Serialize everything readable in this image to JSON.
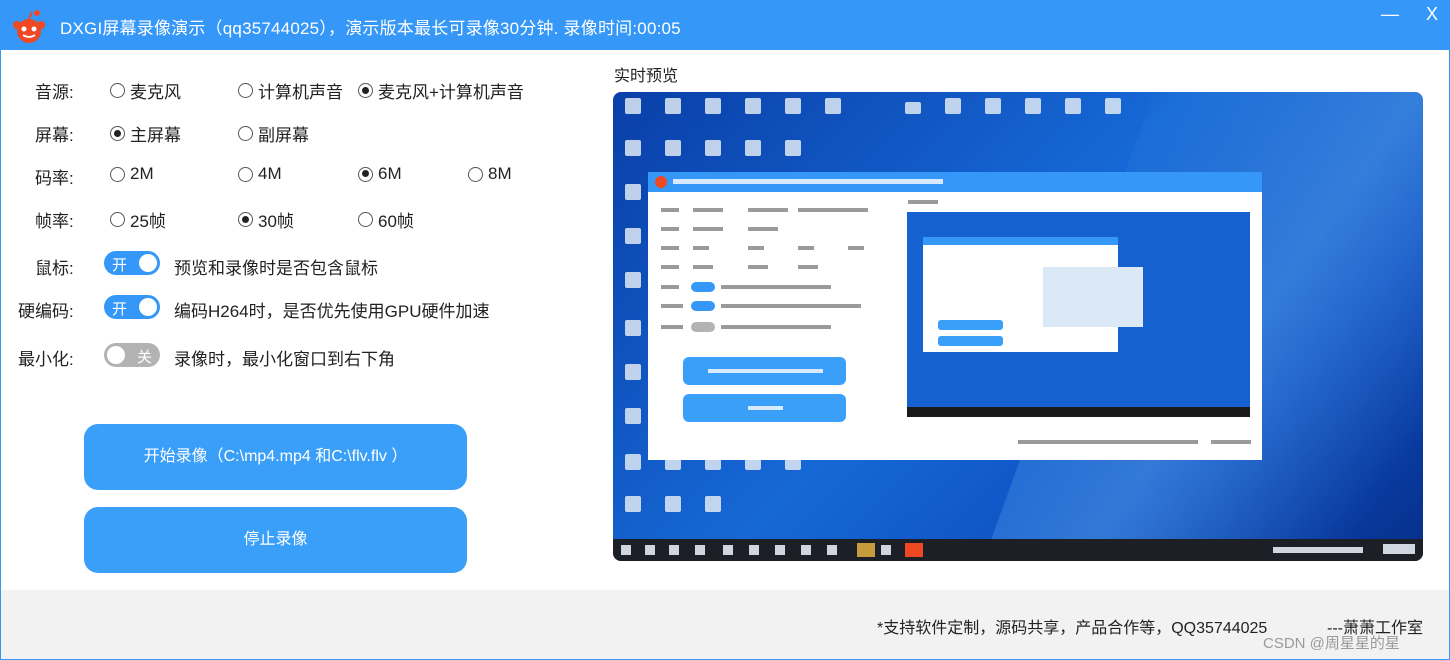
{
  "window": {
    "title": "DXGI屏幕录像演示（qq35744025），演示版本最长可录像30分钟. 录像时间:00:05",
    "minimize_glyph": "—",
    "close_glyph": "X",
    "logo_icon": "reddit-alien-logo-icon"
  },
  "audio": {
    "label": "音源:",
    "options": [
      {
        "label": "麦克风",
        "checked": false
      },
      {
        "label": "计算机声音",
        "checked": false
      },
      {
        "label": "麦克风+计算机声音",
        "checked": true
      }
    ]
  },
  "screen": {
    "label": "屏幕:",
    "options": [
      {
        "label": "主屏幕",
        "checked": true
      },
      {
        "label": "副屏幕",
        "checked": false
      }
    ]
  },
  "bitrate": {
    "label": "码率:",
    "options": [
      {
        "label": "2M",
        "checked": false
      },
      {
        "label": "4M",
        "checked": false
      },
      {
        "label": "6M",
        "checked": true
      },
      {
        "label": "8M",
        "checked": false
      }
    ]
  },
  "framerate": {
    "label": "帧率:",
    "options": [
      {
        "label": "25帧",
        "checked": false
      },
      {
        "label": "30帧",
        "checked": true
      },
      {
        "label": "60帧",
        "checked": false
      }
    ]
  },
  "mouse": {
    "label": "鼠标:",
    "toggle_text": "开",
    "state": "on",
    "description": "预览和录像时是否包含鼠标"
  },
  "hw_encode": {
    "label": "硬编码:",
    "toggle_text": "开",
    "state": "on",
    "description": "编码H264时，是否优先使用GPU硬件加速"
  },
  "minimize": {
    "label": "最小化:",
    "toggle_text": "关",
    "state": "off",
    "description": "录像时，最小化窗口到右下角"
  },
  "buttons": {
    "start_label": "开始录像（C:\\mp4.mp4 和C:\\flv.flv ）",
    "stop_label": "停止录像"
  },
  "preview": {
    "title": "实时预览"
  },
  "footer": {
    "support_text": "*支持软件定制，源码共享，产品合作等，QQ35744025",
    "studio_text": "---萧萧工作室",
    "watermark_text": "CSDN @周星星的星"
  },
  "colors": {
    "accent": "#3597f7",
    "button": "#3a9ff8",
    "toggle_off": "#b3b3b3",
    "footer_bg": "#f2f2f2"
  }
}
